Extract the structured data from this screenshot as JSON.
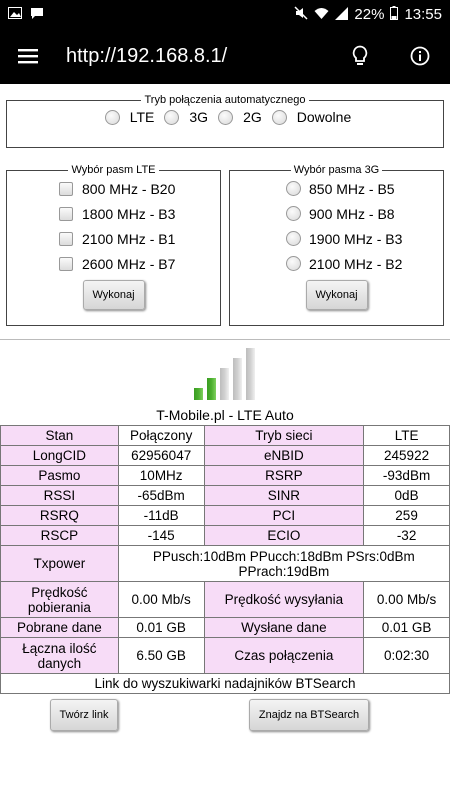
{
  "status_bar": {
    "battery": "22%",
    "time": "13:55",
    "icons": [
      "image-icon",
      "chat-icon",
      "mute-icon",
      "wifi-icon",
      "signal-icon",
      "battery-icon"
    ]
  },
  "app_bar": {
    "url": "http://192.168.8.1/",
    "icons": [
      "menu-icon",
      "lightbulb-icon",
      "info-icon"
    ]
  },
  "mode": {
    "legend": "Tryb połączenia automatycznego",
    "options": [
      "LTE",
      "3G",
      "2G",
      "Dowolne"
    ]
  },
  "lte_bands": {
    "legend": "Wybór pasm LTE",
    "options": [
      "800 MHz - B20",
      "1800 MHz - B3",
      "2100 MHz - B1",
      "2600 MHz - B7"
    ],
    "button": "Wykonaj"
  },
  "umts_bands": {
    "legend": "Wybór pasma 3G",
    "options": [
      "850 MHz - B5",
      "900 MHz - B8",
      "1900 MHz - B3",
      "2100 MHz - B2"
    ],
    "button": "Wykonaj"
  },
  "signal": {
    "level": 2,
    "max": 5,
    "colors": {
      "active": "#4caf2f",
      "inactive": "#d0d0d0"
    }
  },
  "network_title": "T-Mobile.pl - LTE Auto",
  "table": {
    "stan_label": "Stan",
    "stan_value": "Połączony",
    "tryb_label": "Tryb sieci",
    "tryb_value": "LTE",
    "longcid_label": "LongCID",
    "longcid_value": "62956047",
    "enbid_label": "eNBID",
    "enbid_value": "245922",
    "pasmo_label": "Pasmo",
    "pasmo_value": "10MHz",
    "rsrp_label": "RSRP",
    "rsrp_value": "-93dBm",
    "rssi_label": "RSSI",
    "rssi_value": "-65dBm",
    "sinr_label": "SINR",
    "sinr_value": "0dB",
    "rsrq_label": "RSRQ",
    "rsrq_value": "-11dB",
    "pci_label": "PCI",
    "pci_value": "259",
    "rscp_label": "RSCP",
    "rscp_value": "-145",
    "ecio_label": "ECIO",
    "ecio_value": "-32",
    "txpower_label": "Txpower",
    "txpower_value": "PPusch:10dBm PPucch:18dBm PSrs:0dBm PPrach:19dBm",
    "dl_speed_label": "Prędkość pobierania",
    "dl_speed_value": "0.00 Mb/s",
    "ul_speed_label": "Prędkość wysyłania",
    "ul_speed_value": "0.00 Mb/s",
    "dl_data_label": "Pobrane dane",
    "dl_data_value": "0.01 GB",
    "ul_data_label": "Wysłane dane",
    "ul_data_value": "0.01 GB",
    "total_label": "Łączna ilość danych",
    "total_value": "6.50 GB",
    "time_label": "Czas połączenia",
    "time_value": "0:02:30",
    "btsearch_link": "Link do wyszukiwarki nadajników BTSearch"
  },
  "buttons": {
    "create_link": "Twórz link",
    "find_btsearch": "Znajdz na BTSearch"
  }
}
